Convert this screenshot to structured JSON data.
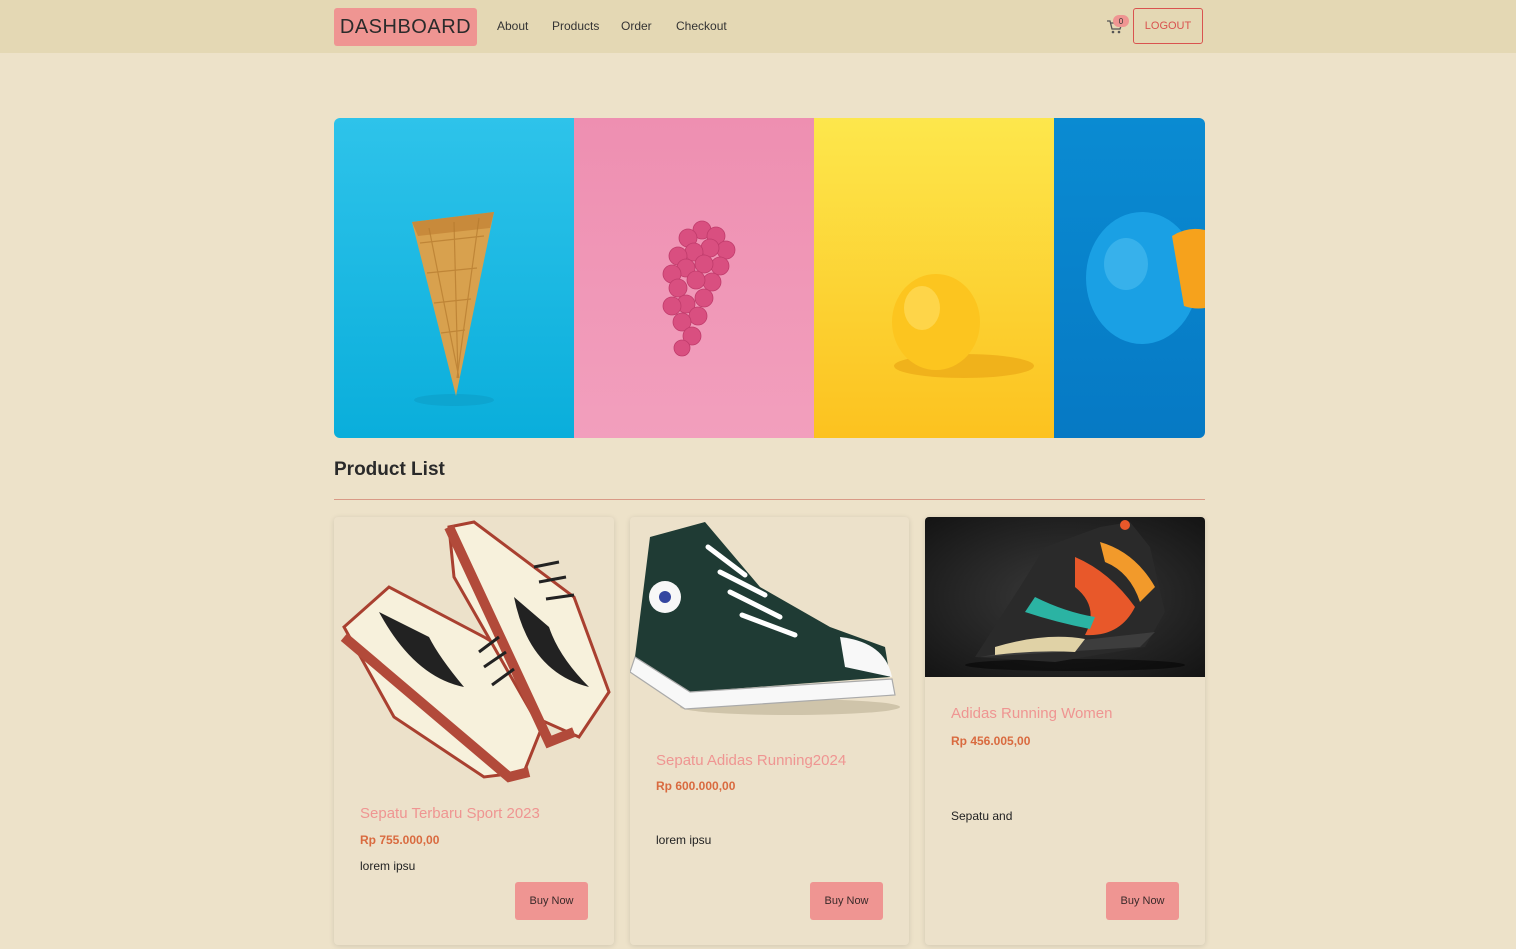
{
  "nav": {
    "brand": "DASHBOARD",
    "links": [
      "About",
      "Products",
      "Order",
      "Checkout"
    ],
    "cart_count": "0",
    "logout_label": "LOGOUT"
  },
  "carousel": {
    "slides": [
      "ice-cream-cone",
      "pink-grapes",
      "yellow-lemon",
      "blue-orange"
    ],
    "colors": [
      "#16b6e0",
      "#ef92b3",
      "#fbd12e",
      "#0a86cf"
    ]
  },
  "section_title": "Product List",
  "products": [
    {
      "name": "Sepatu Terbaru Sport 2023",
      "price": "Rp 755.000,00",
      "desc": "lorem ipsu",
      "button": "Buy Now"
    },
    {
      "name": "Sepatu Adidas Running2024",
      "price": "Rp 600.000,00",
      "desc": "lorem ipsu",
      "button": "Buy Now"
    },
    {
      "name": "Adidas Running Women",
      "price": "Rp 456.005,00",
      "desc": "Sepatu and",
      "button": "Buy Now"
    }
  ],
  "colors": {
    "accent": "#ef9592",
    "price": "#d96a3f",
    "background": "#ede2c9",
    "navbar": "#e4d8b4"
  }
}
